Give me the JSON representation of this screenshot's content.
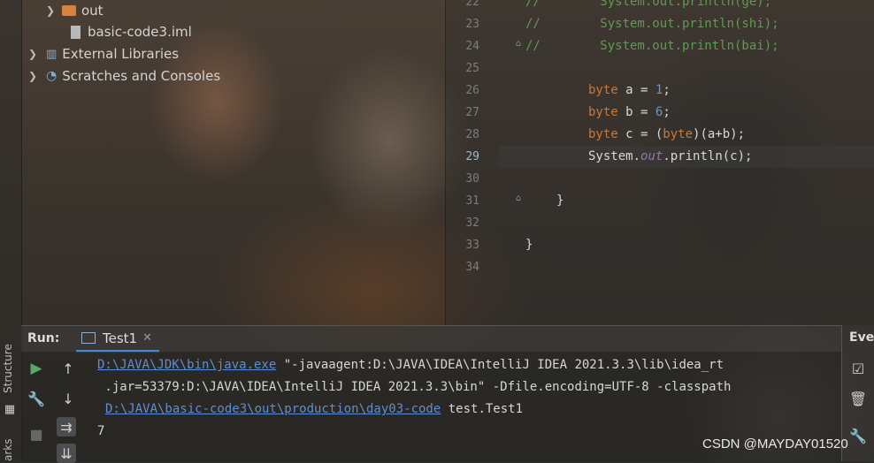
{
  "project_tree": {
    "items": [
      {
        "label": "out",
        "icon": "folder-icon"
      },
      {
        "label": "basic-code3.iml",
        "icon": "file-icon"
      },
      {
        "label": "External Libraries",
        "icon": "library-icon"
      },
      {
        "label": "Scratches and Consoles",
        "icon": "scratches-icon"
      }
    ]
  },
  "side_tabs": {
    "structure": "Structure",
    "bookmarks": "arks"
  },
  "editor": {
    "line_numbers": [
      "22",
      "23",
      "24",
      "25",
      "26",
      "27",
      "28",
      "29",
      "30",
      "31",
      "32",
      "33",
      "34"
    ],
    "lines": [
      {
        "comment": "//",
        "code": "        System.out.println(ge);"
      },
      {
        "comment": "//",
        "code": "        System.out.println(shi);"
      },
      {
        "comment": "//",
        "code": "        System.out.println(bai);"
      },
      {
        "text": ""
      },
      {
        "kw": "byte",
        "name": " a = ",
        "num": "1",
        "end": ";"
      },
      {
        "kw": "byte",
        "name": " b = ",
        "num": "6",
        "end": ";"
      },
      {
        "kw": "byte",
        "name": " c = (",
        "kw2": "byte",
        "end": ")(a+b);"
      },
      {
        "prefix": "System.",
        "field": "out",
        "suffix": ".println(c);"
      },
      {
        "text": ""
      },
      {
        "text": "}"
      },
      {
        "text": ""
      },
      {
        "text": "}"
      },
      {
        "text": ""
      }
    ]
  },
  "run": {
    "label": "Run:",
    "tab": "Test1",
    "console": {
      "line1_link": "D:\\JAVA\\JDK\\bin\\java.exe",
      "line1_rest": " \"-javaagent:D:\\JAVA\\IDEA\\IntelliJ IDEA 2021.3.3\\lib\\idea_rt",
      "line2": " .jar=53379:D:\\JAVA\\IDEA\\IntelliJ IDEA 2021.3.3\\bin\" -Dfile.encoding=UTF-8 -classpath",
      "line3_link": "D:\\JAVA\\basic-code3\\out\\production\\day03-code",
      "line3_rest": " test.Test1",
      "output": "7"
    }
  },
  "event_panel": {
    "label": "Eve"
  },
  "watermark": "CSDN @MAYDAY01520"
}
